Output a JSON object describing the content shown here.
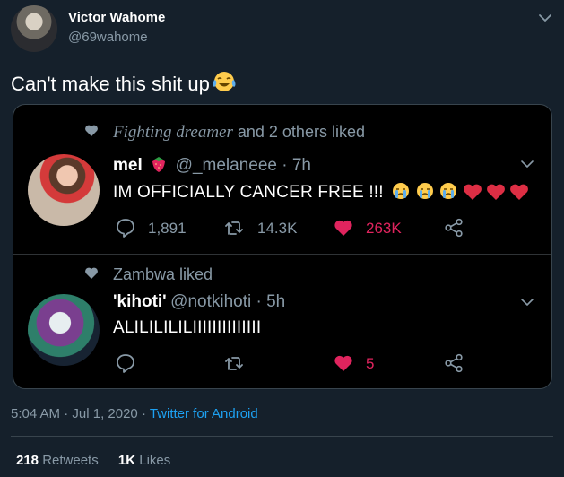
{
  "author": {
    "name": "Victor Wahome",
    "handle": "@69wahome"
  },
  "tweet": {
    "text": "Can't make this shit up",
    "emoji": "face-with-tears-of-joy"
  },
  "embedded": [
    {
      "liked_by_name": "Fighting dreamer",
      "liked_by_suffix": " and 2 others liked",
      "name": "mel",
      "name_emoji": "strawberry",
      "handle": "@_melaneee",
      "time": " · 7h",
      "text": "IM OFFICIALLY CANCER FREE !!!",
      "text_emojis": [
        "crying-face",
        "crying-face",
        "crying-face",
        "red-heart",
        "red-heart",
        "red-heart"
      ],
      "replies": "1,891",
      "retweets": "14.3K",
      "likes": "263K",
      "liked": true
    },
    {
      "liked_by_name": "Zambwa",
      "liked_by_suffix": " liked",
      "name": "'kihoti'",
      "handle": "@notkihoti",
      "time": " · 5h",
      "text": "ALILILILILIIIIIIIIIIIIII",
      "replies": "",
      "retweets": "",
      "likes": "5",
      "liked": true
    }
  ],
  "meta": {
    "time": "5:04 AM",
    "separator": " · ",
    "date": "Jul 1, 2020",
    "source": "Twitter for Android"
  },
  "stats": {
    "retweets_count": "218",
    "retweets_label": " Retweets",
    "likes_count": "1K",
    "likes_label": " Likes"
  },
  "colors": {
    "background": "#15202b",
    "embed_background": "#000000",
    "secondary_text": "#8899a6",
    "like_red": "#e0245e",
    "link_blue": "#1da1f2"
  }
}
